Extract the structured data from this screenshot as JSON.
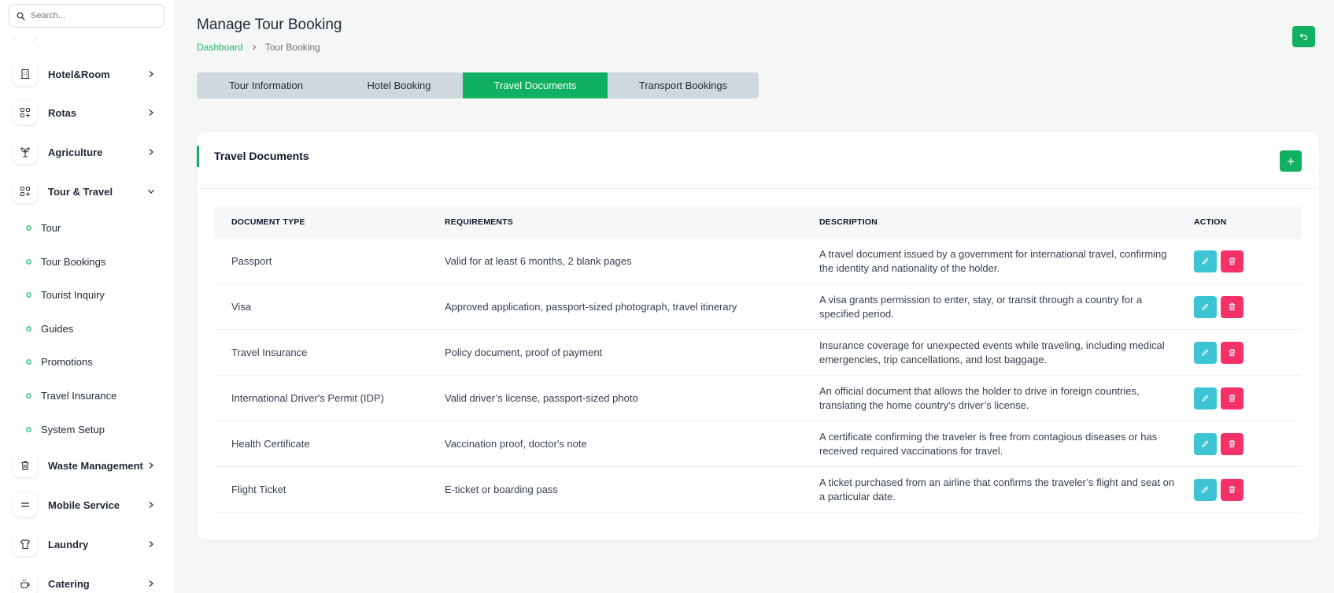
{
  "search": {
    "placeholder": "Search..."
  },
  "sidebar": {
    "items": [
      {
        "label": "Hotel&Room",
        "icon": "building-icon"
      },
      {
        "label": "Rotas",
        "icon": "grid-plus-icon"
      },
      {
        "label": "Agriculture",
        "icon": "plant-icon"
      },
      {
        "label": "Tour & Travel",
        "icon": "grid-plus-icon",
        "expanded": true
      },
      {
        "label": "Waste Management",
        "icon": "trash-icon"
      },
      {
        "label": "Mobile Service",
        "icon": "equals-icon"
      },
      {
        "label": "Laundry",
        "icon": "shirt-icon"
      },
      {
        "label": "Catering",
        "icon": "coffee-icon"
      }
    ],
    "subitems": [
      "Tour",
      "Tour Bookings",
      "Tourist Inquiry",
      "Guides",
      "Promotions",
      "Travel Insurance",
      "System Setup"
    ]
  },
  "header": {
    "title": "Manage Tour Booking",
    "breadcrumb": {
      "home": "Dashboard",
      "current": "Tour Booking"
    }
  },
  "tabs": [
    {
      "label": "Tour Information",
      "active": false
    },
    {
      "label": "Hotel Booking",
      "active": false
    },
    {
      "label": "Travel Documents",
      "active": true
    },
    {
      "label": "Transport Bookings",
      "active": false
    }
  ],
  "card": {
    "title": "Travel Documents"
  },
  "table": {
    "headers": [
      "DOCUMENT TYPE",
      "REQUIREMENTS",
      "DESCRIPTION",
      "ACTION"
    ],
    "rows": [
      {
        "type": "Passport",
        "requirements": "Valid for at least 6 months, 2 blank pages",
        "description": "A travel document issued by a government for international travel, confirming the identity and nationality of the holder."
      },
      {
        "type": "Visa",
        "requirements": "Approved application, passport-sized photograph, travel itinerary",
        "description": "A visa grants permission to enter, stay, or transit through a country for a specified period."
      },
      {
        "type": "Travel Insurance",
        "requirements": "Policy document, proof of payment",
        "description": "Insurance coverage for unexpected events while traveling, including medical emergencies, trip cancellations, and lost baggage."
      },
      {
        "type": "International Driver's Permit (IDP)",
        "requirements": "Valid driver’s license, passport-sized photo",
        "description": "An official document that allows the holder to drive in foreign countries, translating the home country's driver’s license."
      },
      {
        "type": "Health Certificate",
        "requirements": "Vaccination proof, doctor's note",
        "description": "A certificate confirming the traveler is free from contagious diseases or has received required vaccinations for travel."
      },
      {
        "type": "Flight Ticket",
        "requirements": "E-ticket or boarding pass",
        "description": "A ticket purchased from an airline that confirms the traveler’s flight and seat on a particular date."
      }
    ]
  },
  "colors": {
    "accent": "#10b062",
    "edit": "#3cc4d4",
    "delete": "#f5316a",
    "tabs_bg": "#cfd8df"
  }
}
